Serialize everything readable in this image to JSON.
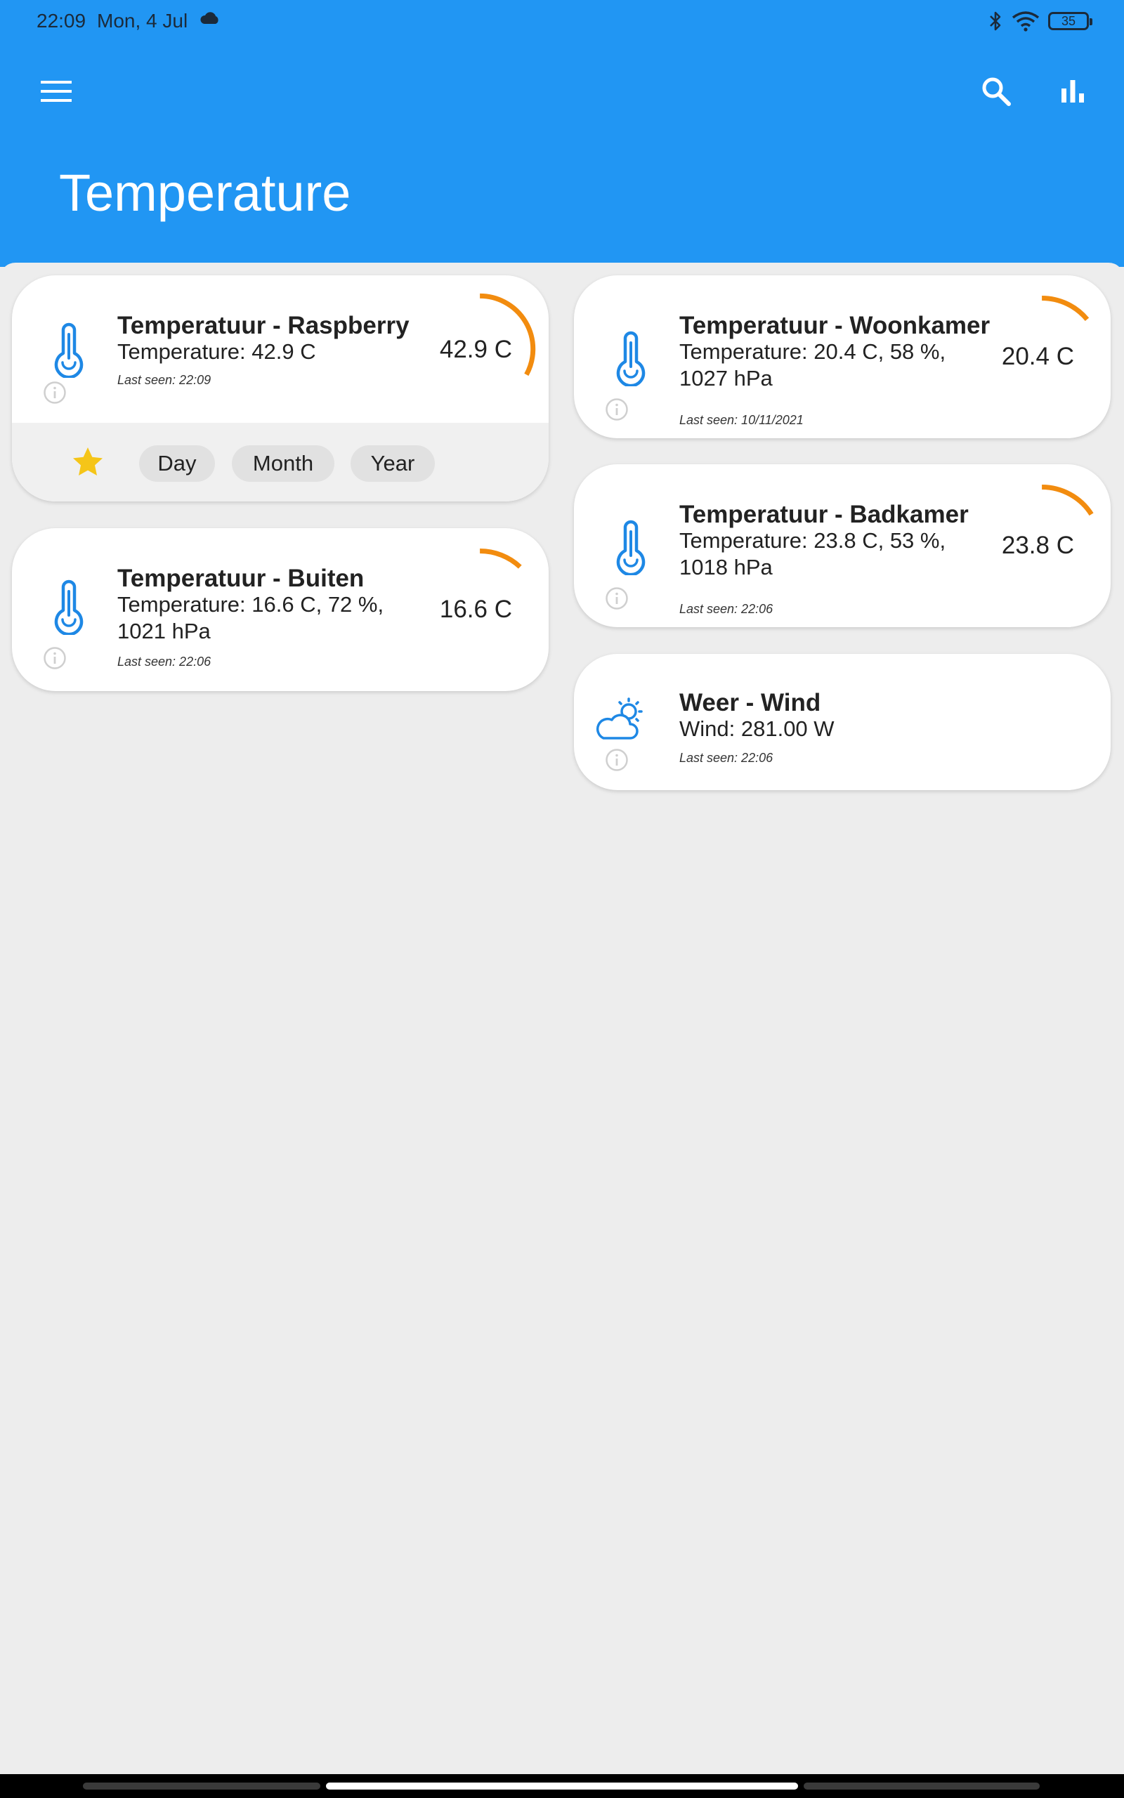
{
  "status_bar": {
    "time": "22:09",
    "date": "Mon, 4 Jul",
    "battery": "35",
    "icons": [
      "cloud-icon",
      "bluetooth-icon",
      "wifi-icon",
      "battery-icon"
    ]
  },
  "toolbar": {
    "title": "Temperature",
    "icons": [
      "menu-icon",
      "search-icon",
      "bar-chart-icon"
    ]
  },
  "colors": {
    "app_bar": "#2196f3",
    "gauge": "#f28c0f",
    "icon_blue": "#1e88e5",
    "star": "#f5c518",
    "background": "#ededed"
  },
  "cards": [
    {
      "title": "Temperatuur - Raspberry",
      "desc": "Temperature: 42.9 C",
      "last_seen": "Last seen: 22:09",
      "value": "42.9 C",
      "icon": "thermometer-icon",
      "gauge_fraction": 0.33,
      "expanded": true,
      "actions": {
        "favorite": "star-icon",
        "chips": [
          "Day",
          "Month",
          "Year"
        ]
      }
    },
    {
      "title": "Temperatuur - Woonkamer",
      "desc": "Temperature: 20.4 C, 58 %, 1027 hPa",
      "last_seen": "Last seen: 10/11/2021",
      "value": "20.4 C",
      "icon": "thermometer-icon",
      "gauge_fraction": 0.14
    },
    {
      "title": "Temperatuur - Buiten",
      "desc": "Temperature: 16.6 C, 72 %, 1021 hPa",
      "last_seen": "Last seen: 22:06",
      "value": "16.6 C",
      "icon": "thermometer-icon",
      "gauge_fraction": 0.12
    },
    {
      "title": "Temperatuur - Badkamer",
      "desc": "Temperature: 23.8 C, 53 %, 1018 hPa",
      "last_seen": "Last seen: 22:06",
      "value": "23.8 C",
      "icon": "thermometer-icon",
      "gauge_fraction": 0.16
    },
    {
      "title": "Weer - Wind",
      "desc": "Wind: 281.00 W",
      "last_seen": "Last seen: 22:06",
      "icon": "partly-cloudy-icon"
    }
  ]
}
